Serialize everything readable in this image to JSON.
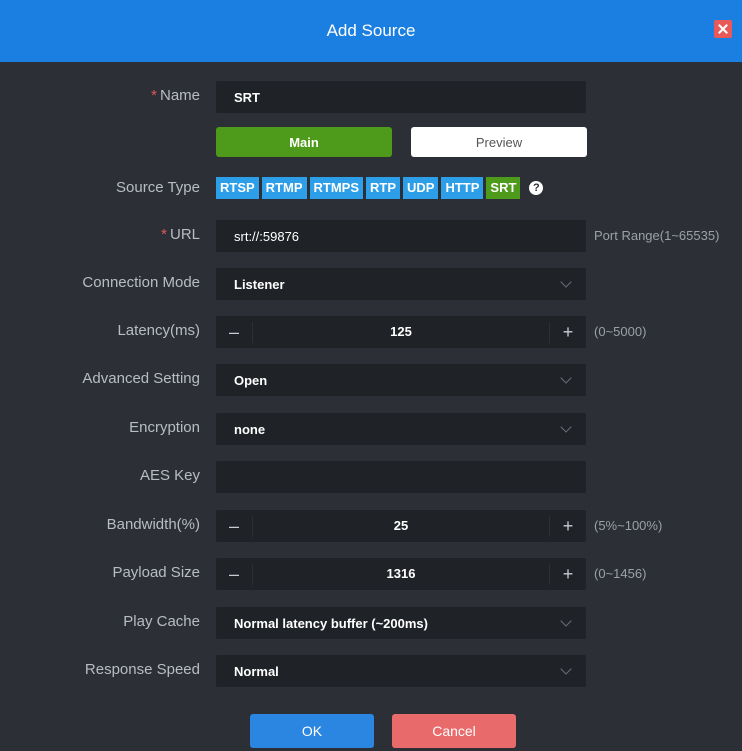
{
  "dialog": {
    "title": "Add Source"
  },
  "form": {
    "required_mark": "*",
    "name": {
      "label": "Name",
      "value": "SRT"
    },
    "mode": {
      "main_label": "Main",
      "preview_label": "Preview"
    },
    "source_type": {
      "label": "Source Type",
      "options": [
        "RTSP",
        "RTMP",
        "RTMPS",
        "RTP",
        "UDP",
        "HTTP",
        "SRT"
      ],
      "selected": "SRT",
      "help_icon": "question-mark"
    },
    "url": {
      "label": "URL",
      "value": "srt://:59876",
      "hint": "Port Range(1~65535)"
    },
    "connection_mode": {
      "label": "Connection Mode",
      "value": "Listener"
    },
    "latency": {
      "label": "Latency(ms)",
      "value": "125",
      "hint": "(0~5000)"
    },
    "advanced_setting": {
      "label": "Advanced Setting",
      "value": "Open"
    },
    "encryption": {
      "label": "Encryption",
      "value": "none"
    },
    "aes_key": {
      "label": "AES Key",
      "value": ""
    },
    "bandwidth": {
      "label": "Bandwidth(%)",
      "value": "25",
      "hint": "(5%~100%)"
    },
    "payload_size": {
      "label": "Payload Size",
      "value": "1316",
      "hint": "(0~1456)"
    },
    "play_cache": {
      "label": "Play Cache",
      "value": "Normal latency buffer (~200ms)"
    },
    "response_speed": {
      "label": "Response Speed",
      "value": "Normal"
    },
    "stepper": {
      "minus": "–",
      "plus": "+"
    }
  },
  "footer": {
    "ok_label": "OK",
    "cancel_label": "Cancel"
  },
  "colors": {
    "accent": "#1a7fe0",
    "active": "#4e9a1a",
    "chip": "#2d9ee8",
    "danger": "#e86a6a"
  }
}
